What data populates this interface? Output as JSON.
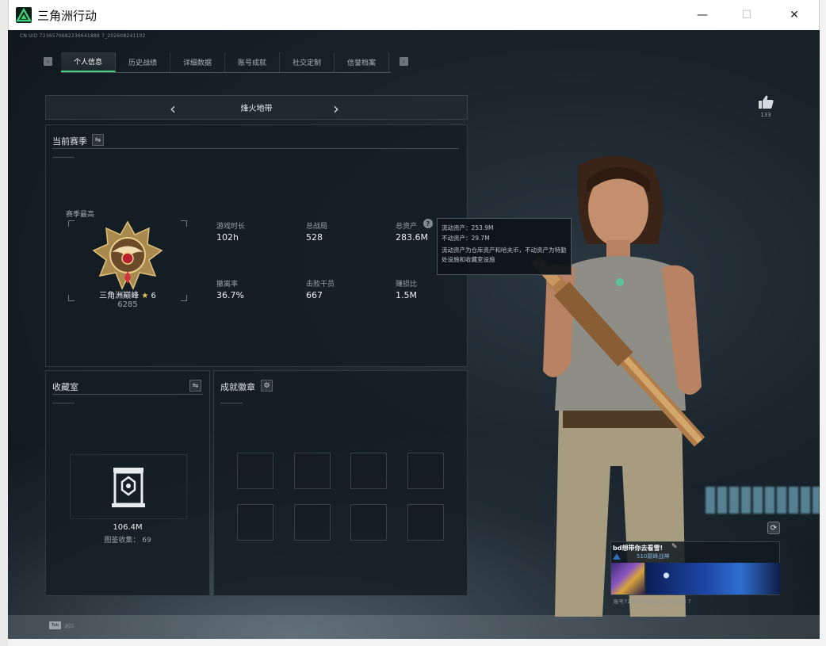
{
  "window": {
    "title": "三角洲行动",
    "minimize": "—",
    "maximize": "☐",
    "close": "✕"
  },
  "player": {
    "uid_line": "CN UID 7236570682236641888 7_202608241102"
  },
  "tabs": {
    "prev": "‹",
    "next": "›",
    "items": [
      {
        "label": "个人信息",
        "active": true
      },
      {
        "label": "历史战绩",
        "active": false
      },
      {
        "label": "详细数据",
        "active": false
      },
      {
        "label": "账号成就",
        "active": false
      },
      {
        "label": "社交定制",
        "active": false
      },
      {
        "label": "信誉档案",
        "active": false
      }
    ]
  },
  "map_selector": {
    "name": "烽火地带",
    "prev": "‹",
    "next": "›"
  },
  "season": {
    "title": "当前赛季",
    "swap_icon": "⇋",
    "highest_label": "赛季最高",
    "rank_name": "三角洲巅峰",
    "rank_star": "★",
    "rank_stars": "6",
    "rank_score": "6285",
    "stats": [
      {
        "label": "游戏时长",
        "value": "102h"
      },
      {
        "label": "总战局",
        "value": "528"
      },
      {
        "label": "总资产",
        "value": "283.6M"
      },
      {
        "label": "撤离率",
        "value": "36.7%"
      },
      {
        "label": "击败干员",
        "value": "667"
      },
      {
        "label": "赚损比",
        "value": "1.5M"
      }
    ],
    "help_icon": "?"
  },
  "tooltip": {
    "liquid": "流动资产：253.9M",
    "fixed": "不动资产：29.7M",
    "note": "流动资产为仓库资产和哈夫币，不动资产为特勤处设施和收藏室设施"
  },
  "vault": {
    "title": "收藏室",
    "swap_icon": "⇋",
    "value": "106.4M",
    "collection_label": "图鉴收集：",
    "collection_count": "69"
  },
  "achievements": {
    "title": "成就徽章",
    "settings_icon": "⚙"
  },
  "likes": {
    "count": "133"
  },
  "profile_card": {
    "refresh_icon": "⟳",
    "name": "bd想带你去看雪!",
    "edit_icon": "✎",
    "rank_text": "510巅峰战神",
    "id_line": "账号7236570682236641888 7"
  },
  "bottom": {
    "key": "Tab",
    "label": "返回"
  },
  "colors": {
    "accent": "#3fd07a",
    "background": "#18222a",
    "gold": "#e7c45a"
  }
}
